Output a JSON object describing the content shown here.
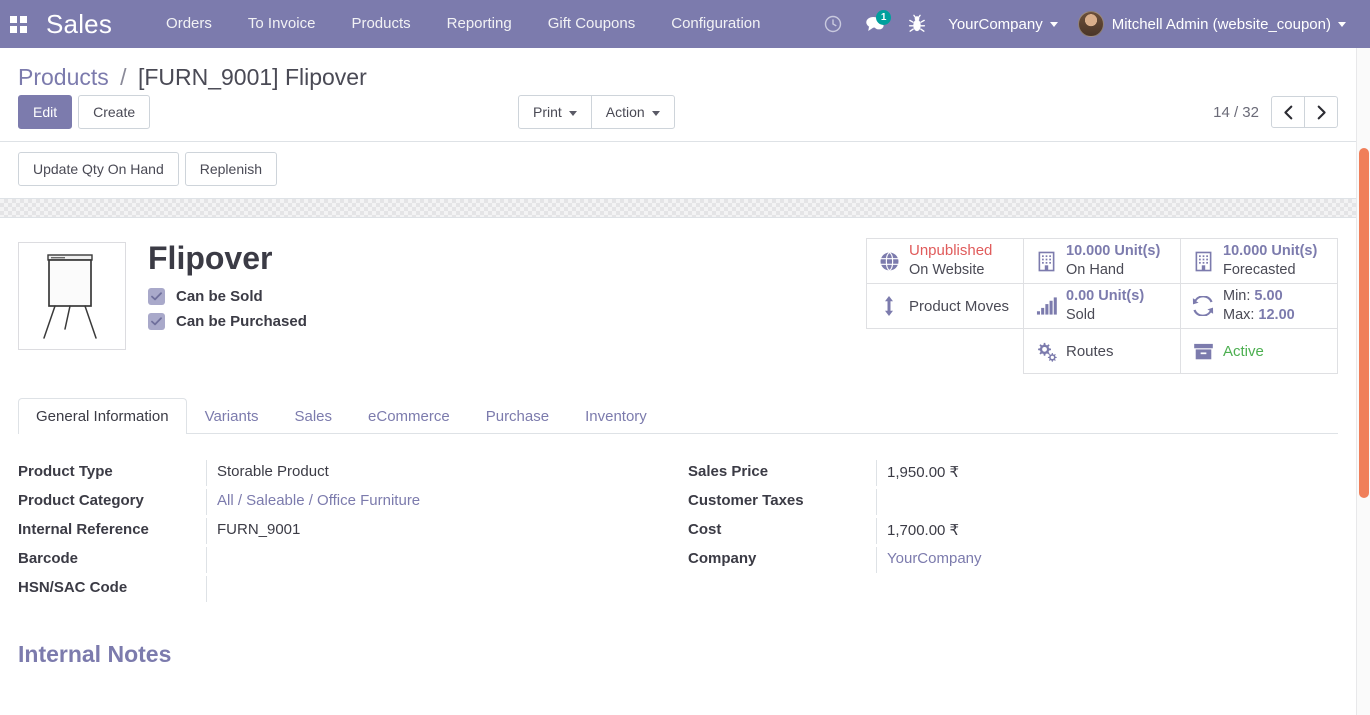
{
  "navbar": {
    "apps_icon": "apps-grid-icon",
    "brand": "Sales",
    "menu": [
      {
        "label": "Orders"
      },
      {
        "label": "To Invoice"
      },
      {
        "label": "Products"
      },
      {
        "label": "Reporting"
      },
      {
        "label": "Gift Coupons"
      },
      {
        "label": "Configuration"
      }
    ],
    "icons": [
      {
        "name": "clock-icon",
        "glyph": "◴"
      },
      {
        "name": "chat-icon",
        "glyph": "💬",
        "badge": "1"
      },
      {
        "name": "bug-icon",
        "glyph": "🐞"
      }
    ],
    "company": "YourCompany",
    "user": "Mitchell Admin (website_coupon)",
    "accent_color": "#7C7BAD",
    "badge_color": "#00A09D"
  },
  "control_panel": {
    "breadcrumb": {
      "root": "Products",
      "separator": "/",
      "current": "[FURN_9001] Flipover"
    },
    "buttons": {
      "edit": "Edit",
      "create": "Create",
      "print": "Print",
      "action": "Action"
    },
    "extra_buttons": [
      {
        "label": "Update Qty On Hand"
      },
      {
        "label": "Replenish"
      }
    ],
    "pager": {
      "text": "14 / 32",
      "prev_icon": "chevron-left-icon",
      "next_icon": "chevron-right-icon",
      "prev_glyph": "‹",
      "next_glyph": "›"
    }
  },
  "product": {
    "image_alt": "flipchart-easel-image",
    "title": "Flipover",
    "checkboxes": [
      {
        "label": "Can be Sold",
        "checked": true
      },
      {
        "label": "Can be Purchased",
        "checked": true
      }
    ]
  },
  "stat_buttons": [
    {
      "icon": "globe-icon",
      "line1": "Unpublished",
      "line2": "On Website",
      "line1_style": "red"
    },
    {
      "icon": "building-icon",
      "line1": "10.000 Unit(s)",
      "line2": "On Hand",
      "line1_style": "purple"
    },
    {
      "icon": "building-icon",
      "line1": "10.000 Unit(s)",
      "line2": "Forecasted",
      "line1_style": "purple"
    },
    {
      "icon": "arrows-vertical-icon",
      "single": "Product Moves"
    },
    {
      "icon": "bar-chart-icon",
      "line1": "0.00 Unit(s)",
      "line2": "Sold",
      "line1_style": "purple"
    },
    {
      "icon": "refresh-icon",
      "min_label": "Min:",
      "min_value": "5.00",
      "max_label": "Max:",
      "max_value": "12.00"
    },
    {
      "icon": "cogs-icon",
      "single": "Routes"
    },
    {
      "icon": "archive-icon",
      "line1": "Active",
      "line1_style": "green"
    }
  ],
  "tabs": [
    {
      "label": "General Information",
      "active": true
    },
    {
      "label": "Variants",
      "active": false
    },
    {
      "label": "Sales",
      "active": false
    },
    {
      "label": "eCommerce",
      "active": false
    },
    {
      "label": "Purchase",
      "active": false
    },
    {
      "label": "Inventory",
      "active": false
    }
  ],
  "form": {
    "left": [
      {
        "label": "Product Type",
        "value": "Storable Product",
        "link": false
      },
      {
        "label": "Product Category",
        "value": "All / Saleable / Office Furniture",
        "link": true
      },
      {
        "label": "Internal Reference",
        "value": "FURN_9001",
        "link": false
      },
      {
        "label": "Barcode",
        "value": "",
        "link": false
      },
      {
        "label": "HSN/SAC Code",
        "value": "",
        "link": false
      }
    ],
    "right": [
      {
        "label": "Sales Price",
        "value": "1,950.00 ₹",
        "link": false
      },
      {
        "label": "Customer Taxes",
        "value": "",
        "link": false
      },
      {
        "label": "Cost",
        "value": "1,700.00 ₹",
        "link": false
      },
      {
        "label": "Company",
        "value": "YourCompany",
        "link": true
      }
    ]
  },
  "internal_notes": {
    "title": "Internal Notes"
  },
  "scrollbar": {
    "thumb_color": "#F07F5A"
  }
}
